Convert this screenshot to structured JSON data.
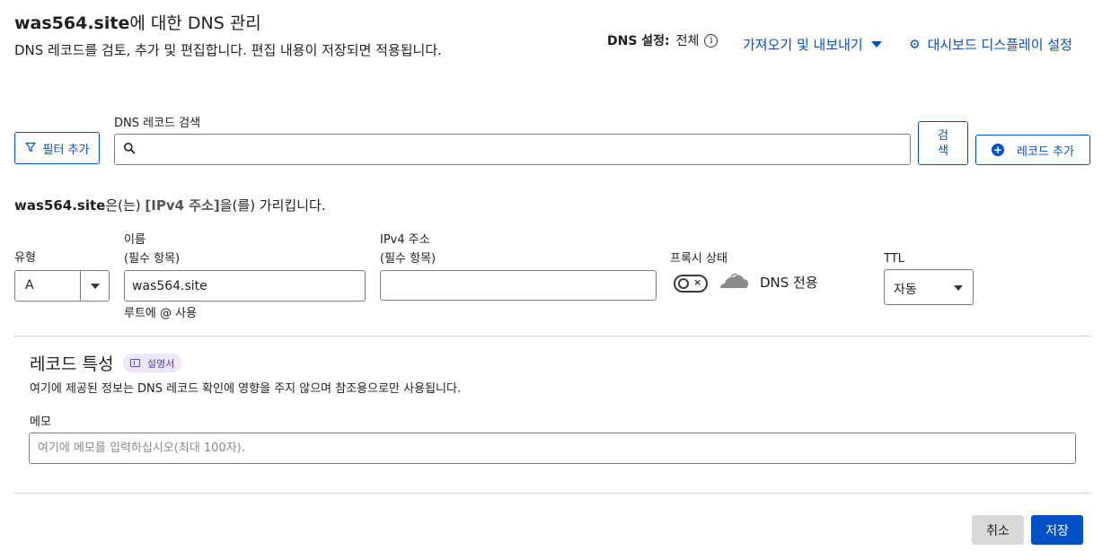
{
  "header": {
    "domain": "was564.site",
    "title_suffix": "에 대한 DNS 관리",
    "description": "DNS 레코드를 검토, 추가 및 편집합니다. 편집 내용이 저장되면 적용됩니다.",
    "dns_setting_label": "DNS 설정:",
    "dns_setting_value": "전체",
    "import_export_label": "가져오기 및 내보내기",
    "dashboard_display_label": "대시보드 디스플레이 설정"
  },
  "toolbar": {
    "filter_label": "필터 추가",
    "search_label": "DNS 레코드 검색",
    "search_value": "",
    "search_button": "검\n색",
    "add_record_label": "레코드 추가"
  },
  "record_form": {
    "points_domain": "was564.site",
    "points_pre": "은(는) ",
    "points_target": "[IPv4 주소]",
    "points_post": "을(를) 가리킵니다.",
    "type_label": "유형",
    "type_value": "A",
    "name_label_1": "이름",
    "name_label_2": "(필수 항목)",
    "name_value": "was564.site",
    "name_hint": "루트에 @ 사용",
    "ipv4_label_1": "IPv4 주소",
    "ipv4_label_2": "(필수 항목)",
    "ipv4_value": "",
    "proxy_label": "프록시 상태",
    "proxy_status": "DNS 전용",
    "ttl_label": "TTL",
    "ttl_value": "자동"
  },
  "record_properties": {
    "title": "레코드 특성",
    "doc_badge": "설명서",
    "description": "여기에 제공된 정보는 DNS 레코드 확인에 영향을 주지 않으며 참조용으로만 사용됩니다.",
    "memo_label": "메모",
    "memo_placeholder": "여기에 메모를 입력하십시오(최대 100자).",
    "memo_value": ""
  },
  "footer": {
    "cancel_label": "취소",
    "save_label": "저장"
  },
  "colors": {
    "accent": "#0051c3",
    "badge_bg": "#ece8f8",
    "badge_text": "#5a3ca0"
  }
}
